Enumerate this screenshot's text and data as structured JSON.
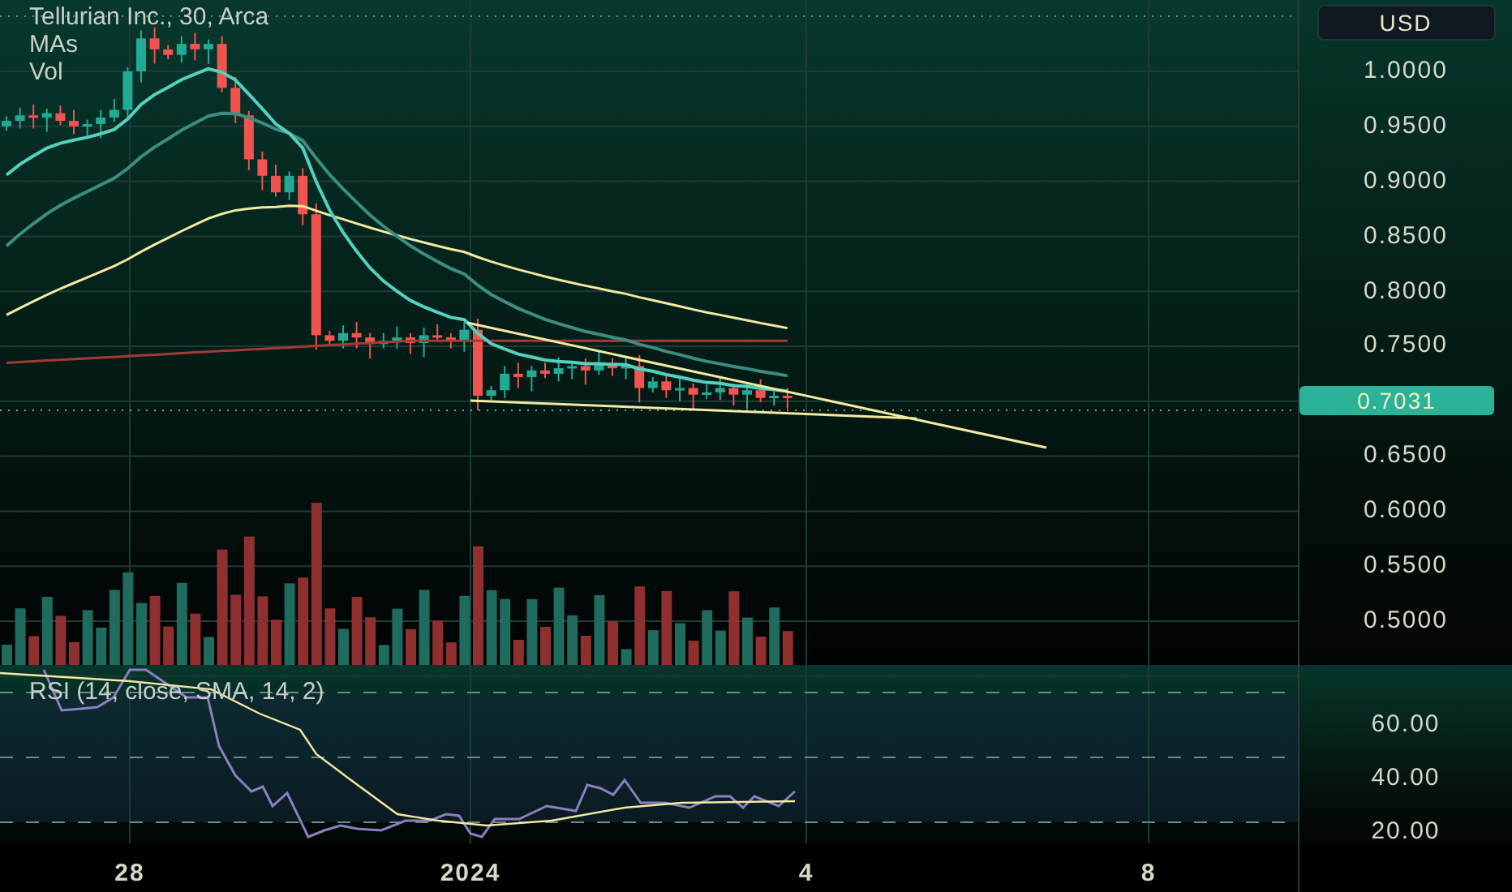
{
  "legend": {
    "title": "Tellurian Inc., 30, Arca",
    "indicators": [
      "MAs",
      "Vol"
    ]
  },
  "currency_button": "USD",
  "price_axis": [
    "1.0000",
    "0.9500",
    "0.9000",
    "0.8500",
    "0.8000",
    "0.7500",
    "0.6500",
    "0.6000",
    "0.5500",
    "0.5000"
  ],
  "last_price": "0.7031",
  "rsi": {
    "title": "RSI (14, close, SMA, 14, 2)",
    "ticks": [
      "60.00",
      "40.00",
      "20.00"
    ]
  },
  "time_axis": [
    "28",
    "2024",
    "4",
    "8"
  ]
}
